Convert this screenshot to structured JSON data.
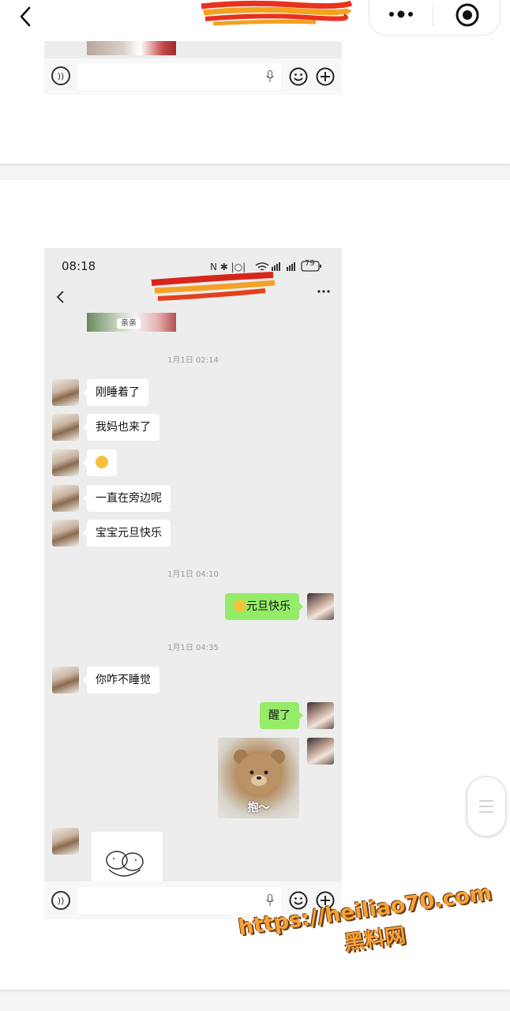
{
  "top_bar": {
    "back_icon": "chevron-left-icon",
    "title_redacted": true,
    "capsule": {
      "more_icon": "more-dots-icon",
      "target_icon": "target-icon"
    }
  },
  "screenshot_2": {
    "status_bar": {
      "time": "08:18",
      "battery": "79"
    },
    "sticker_tag": "亲亲",
    "messages": [
      {
        "type": "timestamp",
        "text": "1月1日 02:14"
      },
      {
        "type": "text",
        "side": "left",
        "text": "刚睡着了"
      },
      {
        "type": "text",
        "side": "left",
        "text": "我妈也来了"
      },
      {
        "type": "emoji",
        "side": "left",
        "emoji": "sweat-smile-emoji"
      },
      {
        "type": "text",
        "side": "left",
        "text": "一直在旁边呢"
      },
      {
        "type": "text",
        "side": "left",
        "text": "宝宝元旦快乐"
      },
      {
        "type": "timestamp",
        "text": "1月1日 04:10"
      },
      {
        "type": "text",
        "side": "right",
        "emoji": "sweat-smile-emoji",
        "text": "元旦快乐"
      },
      {
        "type": "timestamp",
        "text": "1月1日 04:35"
      },
      {
        "type": "text",
        "side": "left",
        "text": "你咋不睡觉"
      },
      {
        "type": "text",
        "side": "right",
        "text": "醒了"
      },
      {
        "type": "sticker",
        "side": "right",
        "caption": "抱～"
      },
      {
        "type": "sticker",
        "side": "left",
        "caption": ""
      }
    ]
  },
  "input_bar": {
    "voice_icon": "voice-icon",
    "mic_icon": "mic-icon",
    "emoji_icon": "emoji-icon",
    "plus_icon": "plus-icon"
  },
  "watermark": {
    "url": "https://heiliao70.com",
    "name": "黑料网"
  },
  "colors": {
    "accent_bubble": "#95ec69",
    "chat_bg": "#ededed"
  }
}
